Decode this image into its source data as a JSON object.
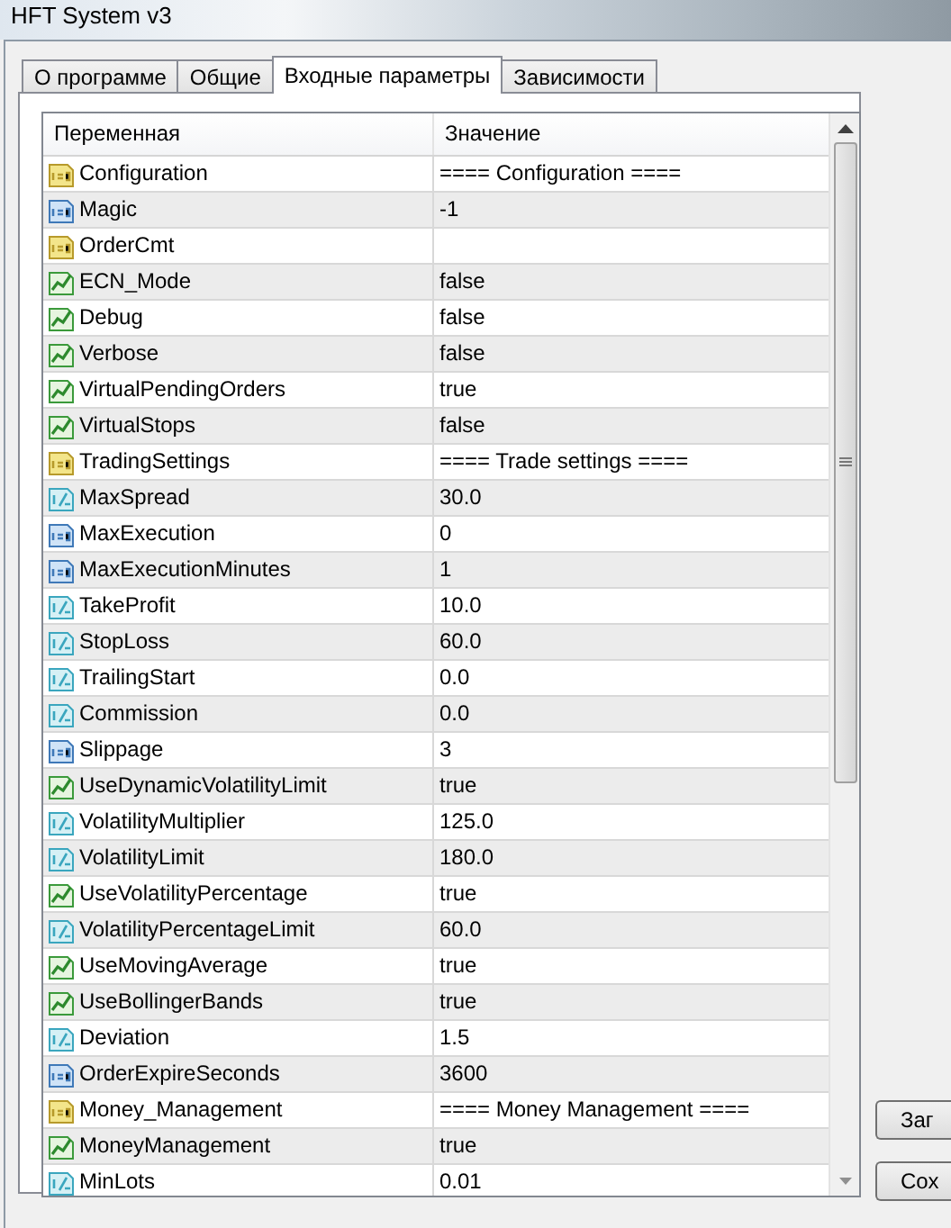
{
  "window": {
    "title": "HFT System v3"
  },
  "tabs": [
    {
      "label": "О программе",
      "selected": false
    },
    {
      "label": "Общие",
      "selected": false
    },
    {
      "label": "Входные параметры",
      "selected": true
    },
    {
      "label": "Зависимости",
      "selected": false
    }
  ],
  "table": {
    "columns": [
      "Переменная",
      "Значение"
    ],
    "rows": [
      {
        "kind": "string",
        "name": "Configuration",
        "value": "==== Configuration ===="
      },
      {
        "kind": "int",
        "name": "Magic",
        "value": "-1"
      },
      {
        "kind": "string",
        "name": "OrderCmt"
      },
      {
        "kind": "bool",
        "name": "ECN_Mode",
        "value": "false"
      },
      {
        "kind": "bool",
        "name": "Debug",
        "value": "false"
      },
      {
        "kind": "bool",
        "name": "Verbose",
        "value": "false"
      },
      {
        "kind": "bool",
        "name": "VirtualPendingOrders",
        "value": "true"
      },
      {
        "kind": "bool",
        "name": "VirtualStops",
        "value": "false"
      },
      {
        "kind": "string",
        "name": "TradingSettings",
        "value": "==== Trade settings ===="
      },
      {
        "kind": "double",
        "name": "MaxSpread",
        "value": "30.0"
      },
      {
        "kind": "int",
        "name": "MaxExecution",
        "value": "0"
      },
      {
        "kind": "int",
        "name": "MaxExecutionMinutes",
        "value": "1"
      },
      {
        "kind": "double",
        "name": "TakeProfit",
        "value": "10.0"
      },
      {
        "kind": "double",
        "name": "StopLoss",
        "value": "60.0"
      },
      {
        "kind": "double",
        "name": "TrailingStart",
        "value": "0.0"
      },
      {
        "kind": "double",
        "name": "Commission",
        "value": "0.0"
      },
      {
        "kind": "int",
        "name": "Slippage",
        "value": "3"
      },
      {
        "kind": "bool",
        "name": "UseDynamicVolatilityLimit",
        "value": "true"
      },
      {
        "kind": "double",
        "name": "VolatilityMultiplier",
        "value": "125.0"
      },
      {
        "kind": "double",
        "name": "VolatilityLimit",
        "value": "180.0"
      },
      {
        "kind": "bool",
        "name": "UseVolatilityPercentage",
        "value": "true"
      },
      {
        "kind": "double",
        "name": "VolatilityPercentageLimit",
        "value": "60.0"
      },
      {
        "kind": "bool",
        "name": "UseMovingAverage",
        "value": "true"
      },
      {
        "kind": "bool",
        "name": "UseBollingerBands",
        "value": "true"
      },
      {
        "kind": "double",
        "name": "Deviation",
        "value": "1.5"
      },
      {
        "kind": "int",
        "name": "OrderExpireSeconds",
        "value": "3600"
      },
      {
        "kind": "string",
        "name": "Money_Management",
        "value": "==== Money Management ===="
      },
      {
        "kind": "bool",
        "name": "MoneyManagement",
        "value": "true"
      },
      {
        "kind": "double",
        "name": "MinLots",
        "value": "0.01"
      }
    ]
  },
  "buttons": [
    "Заг",
    "Сох"
  ]
}
